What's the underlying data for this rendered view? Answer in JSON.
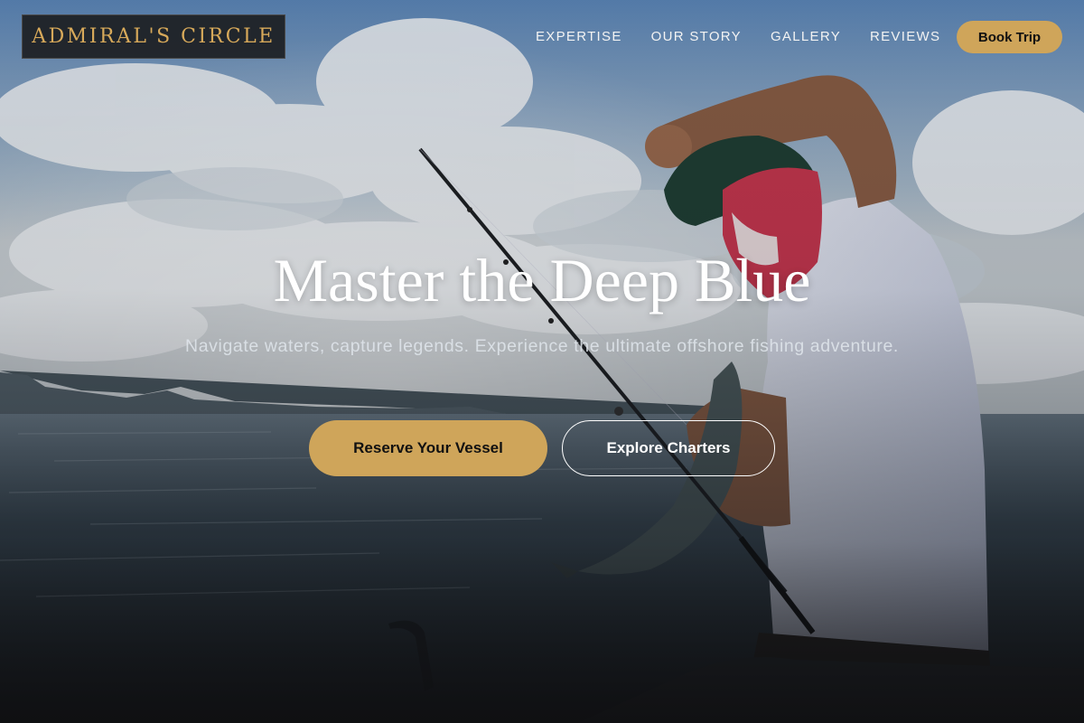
{
  "brand": {
    "logo_text": "ADMIRAL'S CIRCLE",
    "accent_color": "#cfa55a"
  },
  "nav": {
    "items": [
      {
        "label": "EXPERTISE"
      },
      {
        "label": "OUR STORY"
      },
      {
        "label": "GALLERY"
      },
      {
        "label": "REVIEWS"
      }
    ],
    "book_label": "Book Trip"
  },
  "hero": {
    "headline": "Master the Deep Blue",
    "subheadline": "Navigate waters, capture legends. Experience the ultimate offshore fishing adventure.",
    "primary_cta": "Reserve Your Vessel",
    "secondary_cta": "Explore Charters",
    "background_image": "fisherman-holding-fish-on-boat-photo"
  }
}
